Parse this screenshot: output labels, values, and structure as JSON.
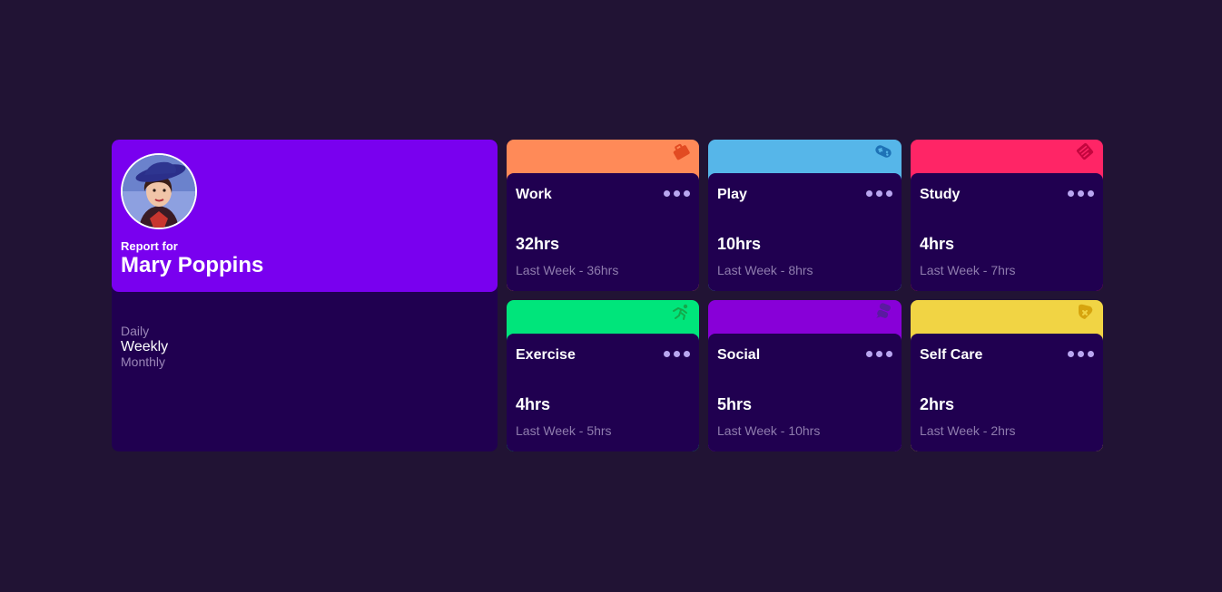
{
  "profile": {
    "report_label": "Report for",
    "name": "Mary Poppins",
    "avatar": "profile-photo",
    "periods": [
      {
        "label": "Daily",
        "active": false
      },
      {
        "label": "Weekly",
        "active": true
      },
      {
        "label": "Monthly",
        "active": false
      }
    ]
  },
  "cards": [
    {
      "title": "Work",
      "hours": "32hrs",
      "last_week": "Last Week - 36hrs",
      "accent": "#ff8a58",
      "icon_color": "#e24b22",
      "icon": "briefcase-icon"
    },
    {
      "title": "Play",
      "hours": "10hrs",
      "last_week": "Last Week - 8hrs",
      "accent": "#56b6e9",
      "icon_color": "#1e72b6",
      "icon": "gamepad-icon"
    },
    {
      "title": "Study",
      "hours": "4hrs",
      "last_week": "Last Week - 7hrs",
      "accent": "#ff2566",
      "icon_color": "#c4053e",
      "icon": "book-icon"
    },
    {
      "title": "Exercise",
      "hours": "4hrs",
      "last_week": "Last Week - 5hrs",
      "accent": "#00e57b",
      "icon_color": "#14a84b",
      "icon": "running-icon"
    },
    {
      "title": "Social",
      "hours": "5hrs",
      "last_week": "Last Week - 10hrs",
      "accent": "#8800d8",
      "icon_color": "#5a1aa0",
      "icon": "chat-icon"
    },
    {
      "title": "Self Care",
      "hours": "2hrs",
      "last_week": "Last Week - 2hrs",
      "accent": "#f1d444",
      "icon_color": "#d6a40e",
      "icon": "heart-icon"
    }
  ]
}
